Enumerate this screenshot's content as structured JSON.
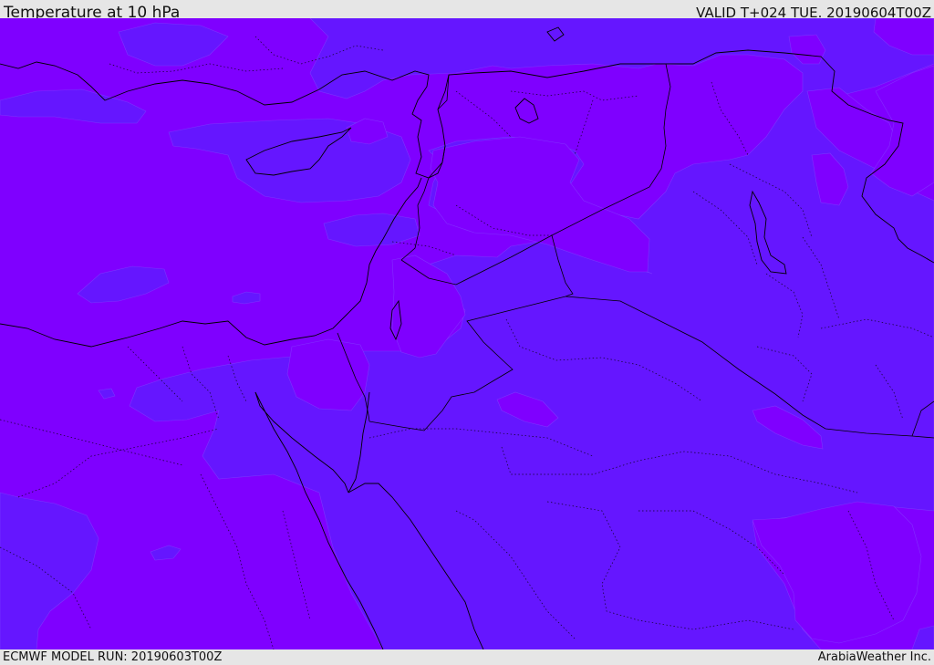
{
  "header": {
    "title": "Temperature at 10 hPa",
    "valid": "VALID T+024 TUE. 20190604T00Z"
  },
  "footer": {
    "model_run": "ECMWF MODEL RUN: 20190603T00Z",
    "credit": "ArabiaWeather Inc."
  },
  "map": {
    "colors": {
      "warmer_band": "#7f00ff",
      "cooler_band": "#6516ff",
      "borders": "#000000"
    }
  }
}
